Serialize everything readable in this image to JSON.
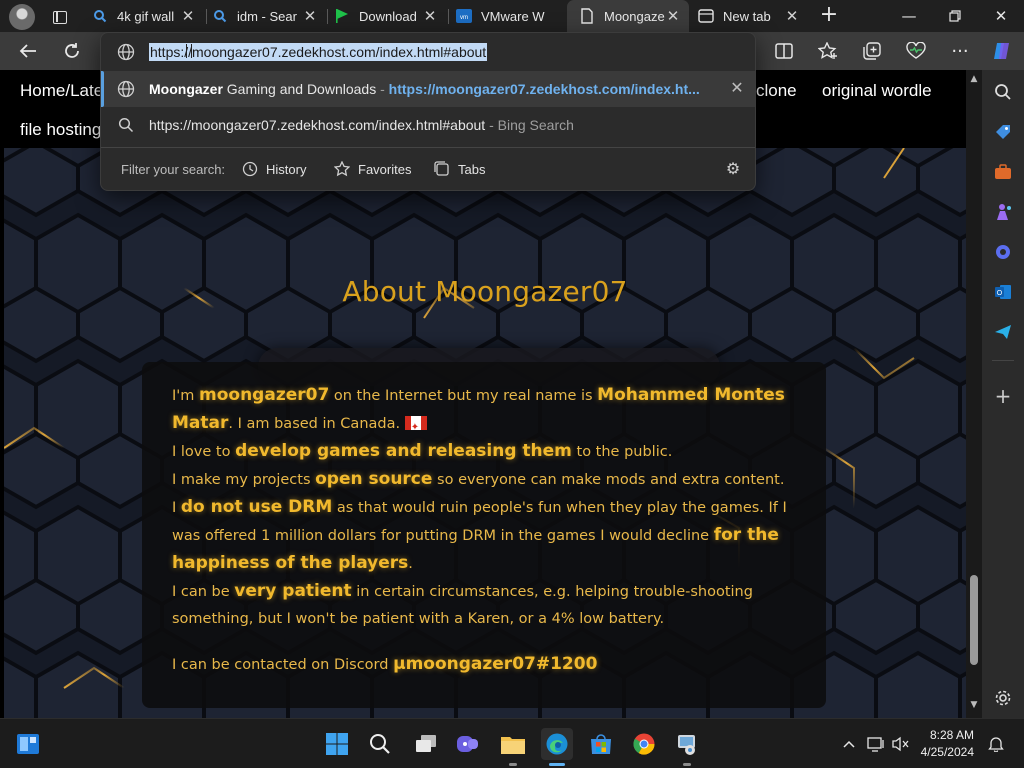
{
  "browser": {
    "tabs": [
      {
        "title": "4k gif wall",
        "icon": "search-icon",
        "active": false
      },
      {
        "title": "idm - Sear",
        "icon": "search-icon",
        "active": false
      },
      {
        "title": "Download",
        "icon": "flag-icon",
        "active": false
      },
      {
        "title": "VMware W",
        "icon": "vmware-icon",
        "active": false
      },
      {
        "title": "Moongaze",
        "icon": "page-icon",
        "active": true
      },
      {
        "title": "New tab",
        "icon": "newtab-icon",
        "active": false
      }
    ],
    "omnibox": {
      "url": "https://moongazer07.zedekhost.com/index.html#about",
      "suggestions": [
        {
          "bold": "Moongazer",
          "text": " Gaming and Downloads",
          "sep": " - ",
          "url": "https://moongazer07.zedekhost.com/index.ht..."
        },
        {
          "text": "https://moongazer07.zedekhost.com/index.html#about",
          "suffix": " - Bing Search"
        }
      ],
      "filter_label": "Filter your search:",
      "filters": [
        "History",
        "Favorites",
        "Tabs"
      ]
    }
  },
  "site": {
    "nav": {
      "home": "Home/Late",
      "clone": "clone",
      "wordle": "original wordle",
      "filehosting": "file hosting"
    },
    "about_title": "About Moongazer07",
    "about": {
      "l1a": "I'm ",
      "l1b": "moongazer07",
      "l1c": " on the Internet but my real name is ",
      "l1d": "Mohammed Montes",
      "l2a": "Matar",
      "l2b": ". I am based in Canada. ",
      "l3a": "I love to ",
      "l3b": "develop games and releasing them",
      "l3c": " to the public.",
      "l4a": "I make my projects ",
      "l4b": "open source",
      "l4c": " so everyone can make mods and extra content.",
      "l5a": "I ",
      "l5b": "do not use DRM",
      "l5c": " as that would ruin people's fun when they play the games. If I",
      "l6a": "was offered 1 million dollars for putting DRM in the games I would decline ",
      "l6b": "for the",
      "l7a": "happiness of the players",
      "l7b": ".",
      "l8a": "I can be ",
      "l8b": "very patient",
      "l8c": " in certain circumstances, e.g. helping trouble-shooting",
      "l9": "something, but I won't be patient with a Karen, or a 4% low battery.",
      "l10a": "I can be contacted on Discord ",
      "l10b": "µmoongazer07#1200"
    }
  },
  "taskbar": {
    "time": "8:28 AM",
    "date": "4/25/2024"
  },
  "colors": {
    "accent_gold": "#d9a11d",
    "highlight_gold": "#f1b92d",
    "url_link": "#6fb2ef",
    "selection": "#c2daf5"
  }
}
